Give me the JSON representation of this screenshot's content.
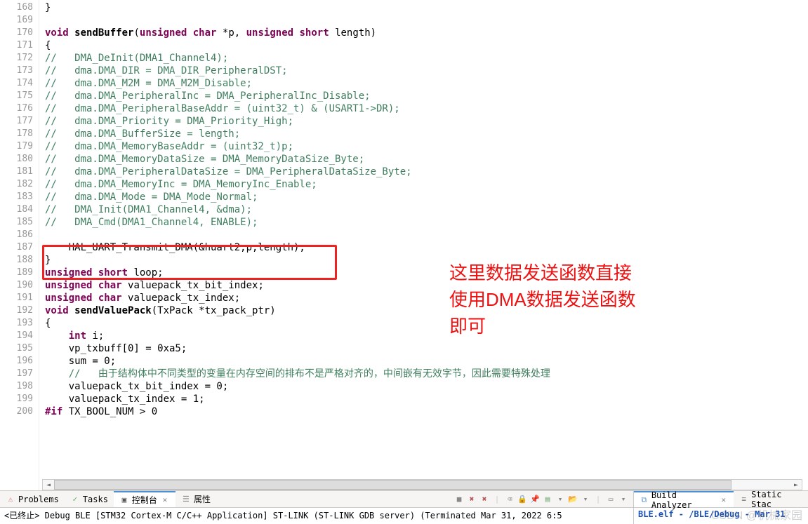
{
  "gutter": {
    "start": 168,
    "end": 200,
    "fold_minus": [
      168,
      170,
      172,
      189,
      192
    ],
    "fold_plus": []
  },
  "code": {
    "168": "}",
    "169": "",
    "170_tokens": [
      {
        "t": "void ",
        "c": "kw"
      },
      {
        "t": "sendBuffer",
        "c": "fn",
        "bold": true
      },
      {
        "t": "(",
        "c": "txt"
      },
      {
        "t": "unsigned char ",
        "c": "kw"
      },
      {
        "t": "*p, ",
        "c": "txt"
      },
      {
        "t": "unsigned short ",
        "c": "kw"
      },
      {
        "t": "length)",
        "c": "txt"
      }
    ],
    "171": "{",
    "172": "//   DMA_DeInit(DMA1_Channel4);",
    "173": "//   dma.DMA_DIR = DMA_DIR_PeripheralDST;",
    "174": "//   dma.DMA_M2M = DMA_M2M_Disable;",
    "175": "//   dma.DMA_PeripheralInc = DMA_PeripheralInc_Disable;",
    "176": "//   dma.DMA_PeripheralBaseAddr = (uint32_t) & (USART1->DR);",
    "177": "//   dma.DMA_Priority = DMA_Priority_High;",
    "178": "//   dma.DMA_BufferSize = length;",
    "179": "//   dma.DMA_MemoryBaseAddr = (uint32_t)p;",
    "180": "//   dma.DMA_MemoryDataSize = DMA_MemoryDataSize_Byte;",
    "181": "//   dma.DMA_PeripheralDataSize = DMA_PeripheralDataSize_Byte;",
    "182": "//   dma.DMA_MemoryInc = DMA_MemoryInc_Enable;",
    "183": "//   dma.DMA_Mode = DMA_Mode_Normal;",
    "184": "//   DMA_Init(DMA1_Channel4, &dma);",
    "185": "//   DMA_Cmd(DMA1_Channel4, ENABLE);",
    "186": "",
    "187": "    HAL_UART_Transmit_DMA(&huart2,p,length);",
    "188": "}",
    "189_tokens": [
      {
        "t": "unsigned short ",
        "c": "kw"
      },
      {
        "t": "loop;",
        "c": "txt"
      }
    ],
    "190_tokens": [
      {
        "t": "unsigned char ",
        "c": "kw"
      },
      {
        "t": "valuepack_tx_bit_index;",
        "c": "txt"
      }
    ],
    "191_tokens": [
      {
        "t": "unsigned char ",
        "c": "kw"
      },
      {
        "t": "valuepack_tx_index;",
        "c": "txt"
      }
    ],
    "192_tokens": [
      {
        "t": "void ",
        "c": "kw"
      },
      {
        "t": "sendValuePack",
        "c": "fn",
        "bold": true
      },
      {
        "t": "(TxPack *tx_pack_ptr)",
        "c": "txt"
      }
    ],
    "193": "{",
    "194_tokens": [
      {
        "t": "    ",
        "c": "txt"
      },
      {
        "t": "int ",
        "c": "kw"
      },
      {
        "t": "i;",
        "c": "txt"
      }
    ],
    "195": "    vp_txbuff[0] = 0xa5;",
    "196": "    sum = 0;",
    "197": "    //   由于结构体中不同类型的变量在内存空间的排布不是严格对齐的，中间嵌有无效字节，因此需要特殊处理",
    "198": "    valuepack_tx_bit_index = 0;",
    "199": "    valuepack_tx_index = 1;",
    "200_tokens": [
      {
        "t": "#if",
        "c": "kw"
      },
      {
        "t": " TX_BOOL_NUM > 0",
        "c": "txt"
      }
    ]
  },
  "annotation": {
    "line1": "这里数据发送函数直接",
    "line2": "使用DMA数据发送函数",
    "line3": "即可"
  },
  "bottom": {
    "tabs": {
      "problems": "Problems",
      "tasks": "Tasks",
      "console": "控制台",
      "properties": "属性"
    },
    "console_text": "<已终止> Debug BLE [STM32 Cortex-M C/C++ Application] ST-LINK (ST-LINK GDB server) (Terminated Mar 31, 2022 6:5",
    "build_tab": "Build Analyzer",
    "static_tab": "Static Stac",
    "build_content": "BLE.elf - /BLE/Debug - Mar 31"
  },
  "watermark": "CSDN @机械家园"
}
